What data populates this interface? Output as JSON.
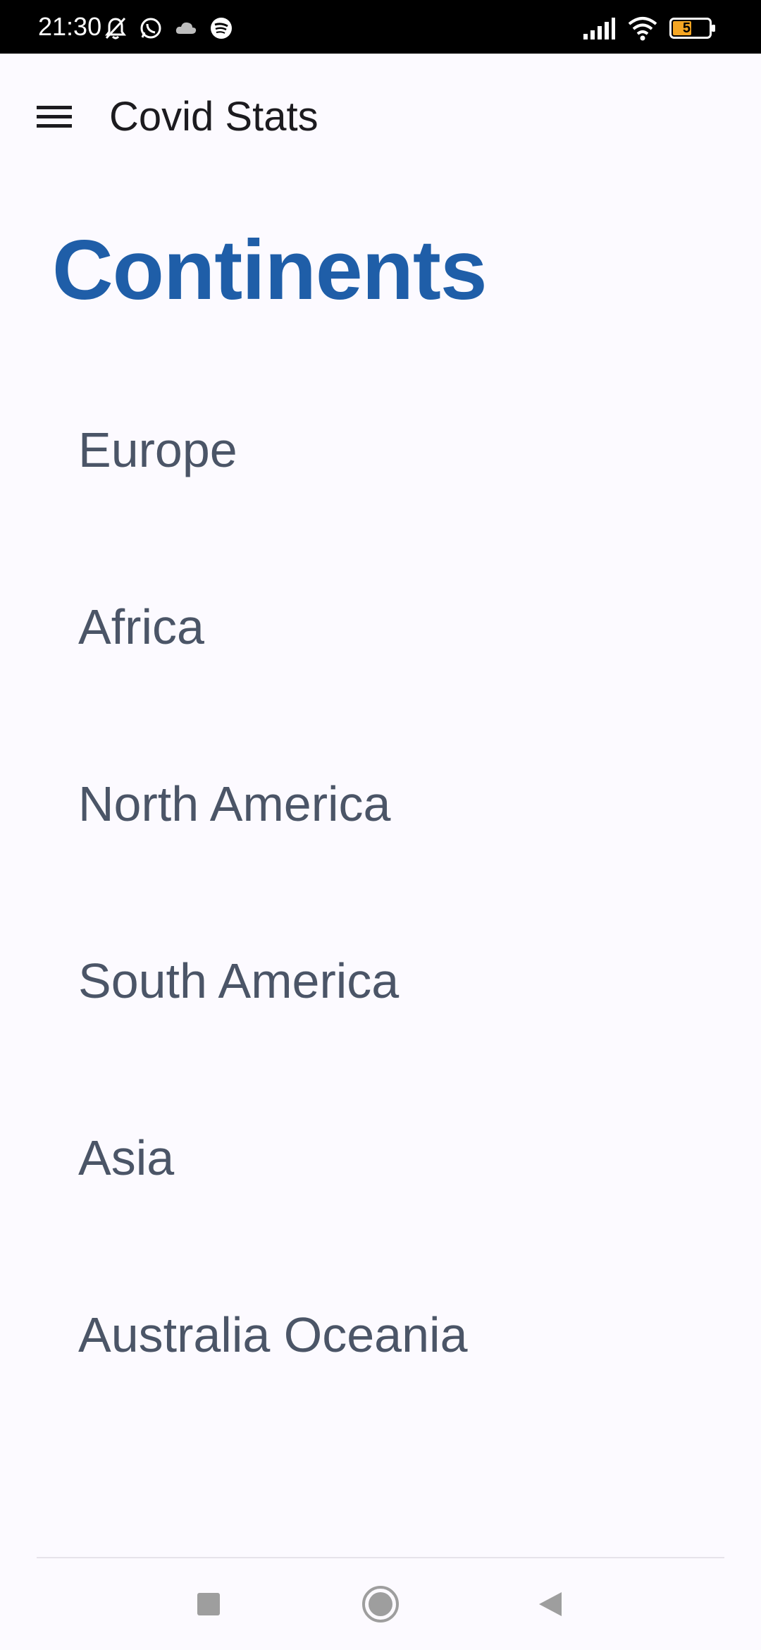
{
  "status_bar": {
    "time": "21:30",
    "battery_level": "51",
    "icons_left": [
      "mute-bell-icon",
      "whatsapp-icon",
      "cloud-icon",
      "spotify-icon"
    ],
    "icons_right": [
      "signal-icon",
      "wifi-icon",
      "battery-icon"
    ],
    "battery_color": "#f5a623"
  },
  "app_bar": {
    "menu_icon": "hamburger-menu-icon",
    "title": "Covid Stats"
  },
  "main": {
    "heading": "Continents",
    "continents": [
      {
        "label": "Europe"
      },
      {
        "label": "Africa"
      },
      {
        "label": "North America"
      },
      {
        "label": "South America"
      },
      {
        "label": "Asia"
      },
      {
        "label": "Australia Oceania"
      }
    ]
  },
  "nav_bar": {
    "buttons": [
      "recents-icon",
      "home-icon",
      "back-icon"
    ]
  },
  "colors": {
    "accent": "#1f5ea8",
    "list_text": "#4b5567",
    "background": "#fcfaff",
    "title_text": "#1c1b1f"
  }
}
